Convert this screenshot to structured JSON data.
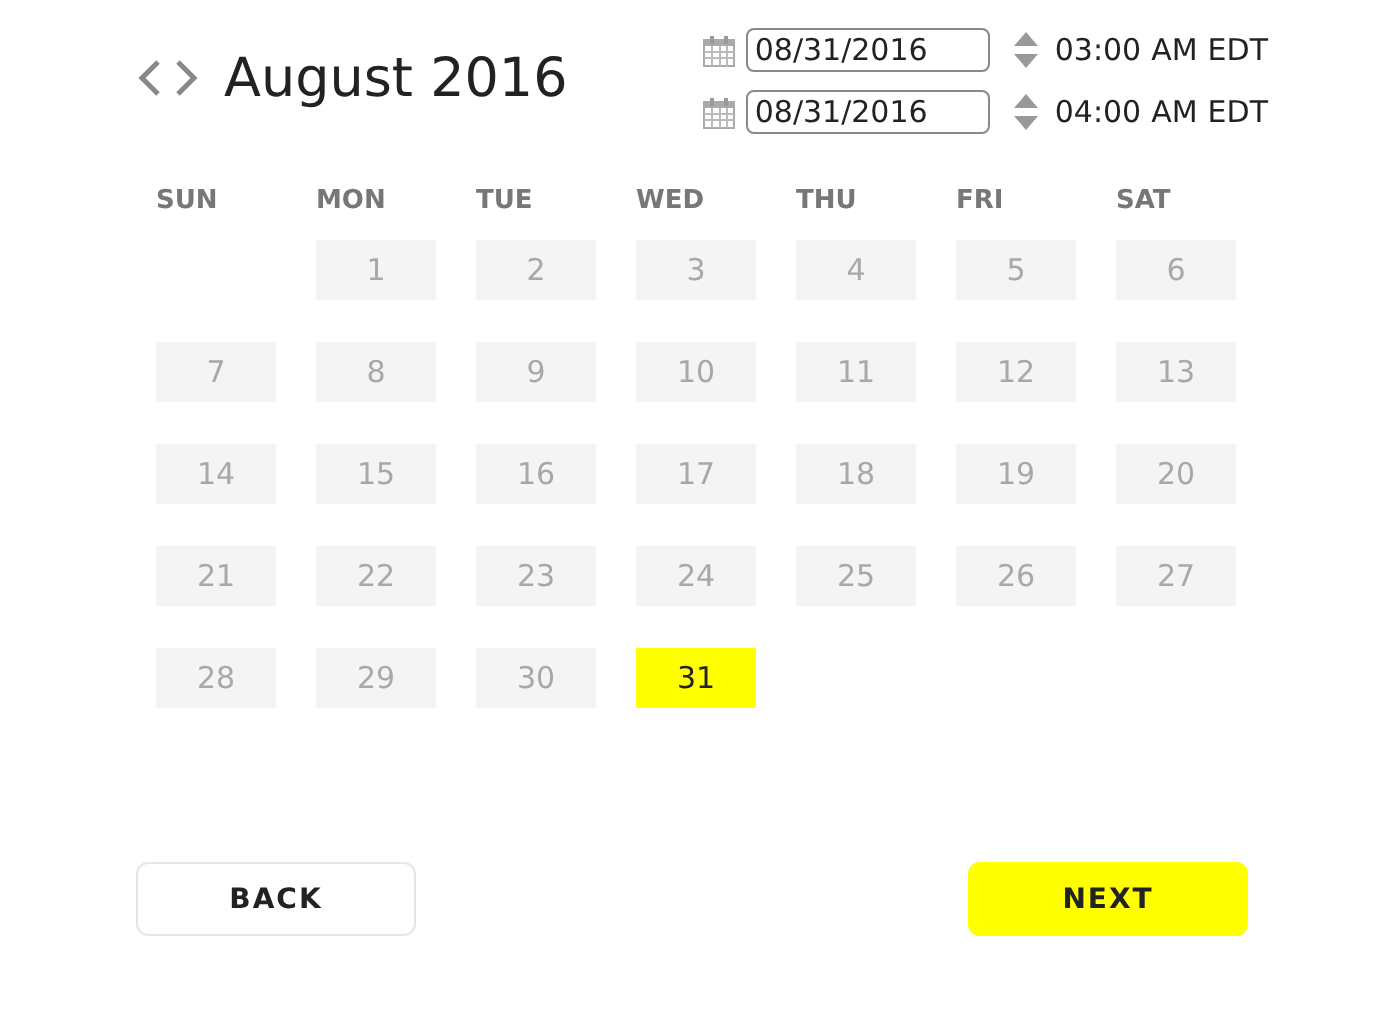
{
  "header": {
    "month_title": "August 2016"
  },
  "ranges": [
    {
      "date": "08/31/2016",
      "time": "03:00",
      "ampm": "AM",
      "zone": "EDT"
    },
    {
      "date": "08/31/2016",
      "time": "04:00",
      "ampm": "AM",
      "zone": "EDT"
    }
  ],
  "weekdays": [
    "SUN",
    "MON",
    "TUE",
    "WED",
    "THU",
    "FRI",
    "SAT"
  ],
  "days": [
    {
      "label": "1",
      "disabled": true,
      "selected": false
    },
    {
      "label": "2",
      "disabled": true,
      "selected": false
    },
    {
      "label": "3",
      "disabled": true,
      "selected": false
    },
    {
      "label": "4",
      "disabled": true,
      "selected": false
    },
    {
      "label": "5",
      "disabled": true,
      "selected": false
    },
    {
      "label": "6",
      "disabled": true,
      "selected": false
    },
    {
      "label": "7",
      "disabled": true,
      "selected": false
    },
    {
      "label": "8",
      "disabled": true,
      "selected": false
    },
    {
      "label": "9",
      "disabled": true,
      "selected": false
    },
    {
      "label": "10",
      "disabled": true,
      "selected": false
    },
    {
      "label": "11",
      "disabled": true,
      "selected": false
    },
    {
      "label": "12",
      "disabled": true,
      "selected": false
    },
    {
      "label": "13",
      "disabled": true,
      "selected": false
    },
    {
      "label": "14",
      "disabled": true,
      "selected": false
    },
    {
      "label": "15",
      "disabled": true,
      "selected": false
    },
    {
      "label": "16",
      "disabled": true,
      "selected": false
    },
    {
      "label": "17",
      "disabled": true,
      "selected": false
    },
    {
      "label": "18",
      "disabled": true,
      "selected": false
    },
    {
      "label": "19",
      "disabled": true,
      "selected": false
    },
    {
      "label": "20",
      "disabled": true,
      "selected": false
    },
    {
      "label": "21",
      "disabled": true,
      "selected": false
    },
    {
      "label": "22",
      "disabled": true,
      "selected": false
    },
    {
      "label": "23",
      "disabled": true,
      "selected": false
    },
    {
      "label": "24",
      "disabled": true,
      "selected": false
    },
    {
      "label": "25",
      "disabled": true,
      "selected": false
    },
    {
      "label": "26",
      "disabled": true,
      "selected": false
    },
    {
      "label": "27",
      "disabled": true,
      "selected": false
    },
    {
      "label": "28",
      "disabled": true,
      "selected": false
    },
    {
      "label": "29",
      "disabled": true,
      "selected": false
    },
    {
      "label": "30",
      "disabled": true,
      "selected": false
    },
    {
      "label": "31",
      "disabled": false,
      "selected": true
    }
  ],
  "buttons": [
    {
      "label": "BACK",
      "kind": "secondary"
    },
    {
      "label": "NEXT",
      "kind": "primary"
    }
  ]
}
